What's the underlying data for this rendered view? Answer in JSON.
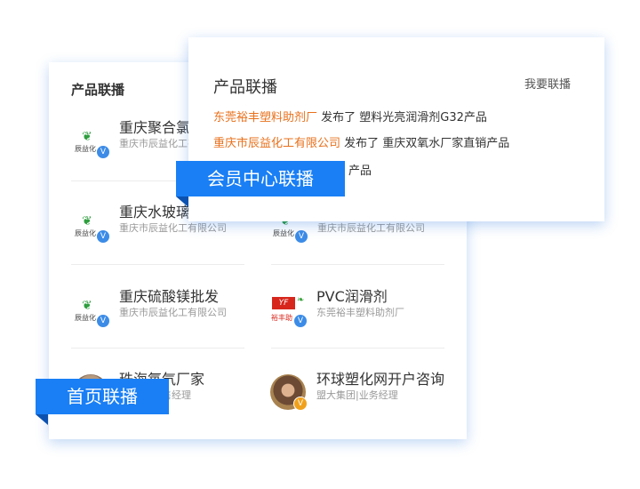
{
  "home": {
    "title": "产品联播",
    "label": "首页联播",
    "items": [
      {
        "name": "重庆聚合氯化",
        "sub": "重庆市辰益化工有限公司",
        "logo": "chenyi-logo",
        "logo_text": "辰益化"
      },
      {
        "name": "重庆水玻璃",
        "sub": "重庆市辰益化工有限公司",
        "logo": "chenyi-logo",
        "logo_text": "辰益化"
      },
      {
        "name": "",
        "sub": "重庆市辰益化工有限公司",
        "logo": "chenyi-logo",
        "logo_text": "辰益化"
      },
      {
        "name": "重庆硫酸镁批发",
        "sub": "重庆市辰益化工有限公司",
        "logo": "chenyi-logo",
        "logo_text": "辰益化"
      },
      {
        "name": "PVC润滑剂",
        "sub": "东莞裕丰塑料助剂厂",
        "logo": "yufeng-logo",
        "logo_text": "YF",
        "logo_sub": "裕丰助"
      },
      {
        "name": "珠海氧气厂家",
        "sub": "售经理",
        "logo": "person-avatar"
      },
      {
        "name": "环球塑化网开户咨询",
        "sub": "盟大集团|业务经理",
        "logo": "person-avatar"
      }
    ]
  },
  "member": {
    "title": "产品联播",
    "label": "会员中心联播",
    "link": "我要联播",
    "feed": [
      {
        "company": "东莞裕丰塑料助剂厂",
        "action": " 发布了 ",
        "product": "塑料光亮润滑剂G32产品"
      },
      {
        "company": "重庆市辰益化工有限公司",
        "action": " 发布了 ",
        "product": "重庆双氧水厂家直销产品"
      },
      {
        "company": "",
        "action": "",
        "product": "产品"
      }
    ]
  },
  "colors": {
    "accent": "#1a7ff5",
    "company": "#e8711c",
    "badge": "#3c8ce7",
    "badge_gold": "#f0a11c"
  },
  "badge_letter": "V"
}
